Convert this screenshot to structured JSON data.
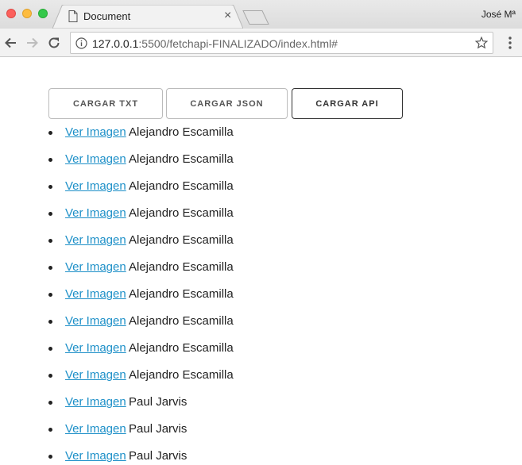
{
  "browser": {
    "tab_title": "Document",
    "tab_close": "×",
    "profile_name": "José Mª",
    "url_host": "127.0.0.1",
    "url_rest": ":5500/fetchapi-FINALIZADO/index.html#"
  },
  "buttons": {
    "txt_label": "CARGAR TXT",
    "json_label": "CARGAR JSON",
    "api_label": "CARGAR API"
  },
  "list": {
    "link_label": "Ver Imagen",
    "items": [
      {
        "name": "Alejandro Escamilla"
      },
      {
        "name": "Alejandro Escamilla"
      },
      {
        "name": "Alejandro Escamilla"
      },
      {
        "name": "Alejandro Escamilla"
      },
      {
        "name": "Alejandro Escamilla"
      },
      {
        "name": "Alejandro Escamilla"
      },
      {
        "name": "Alejandro Escamilla"
      },
      {
        "name": "Alejandro Escamilla"
      },
      {
        "name": "Alejandro Escamilla"
      },
      {
        "name": "Alejandro Escamilla"
      },
      {
        "name": "Paul Jarvis"
      },
      {
        "name": "Paul Jarvis"
      },
      {
        "name": "Paul Jarvis"
      }
    ]
  },
  "colors": {
    "link": "#1e90c8",
    "active_button_border": "#333333"
  }
}
